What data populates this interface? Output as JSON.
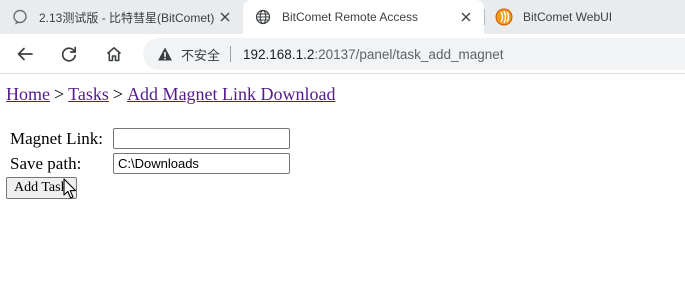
{
  "browser": {
    "tabs": [
      {
        "title": "2.13测试版 - 比特彗星(BitComet)",
        "favicon": "chat-bubble-icon",
        "active": false,
        "closable": true
      },
      {
        "title": "BitComet Remote Access",
        "favicon": "globe-icon",
        "active": true,
        "closable": true
      },
      {
        "title": "BitComet WebUI",
        "favicon": "bitcomet-logo-icon",
        "active": false,
        "closable": false
      }
    ],
    "toolbar": {
      "back_icon": "arrow-left-icon",
      "reload_icon": "reload-icon",
      "home_icon": "home-icon"
    },
    "address_bar": {
      "security_label": "不安全",
      "security_icon": "warning-triangle-icon",
      "url_host": "192.168.1.2",
      "url_rest": ":20137/panel/task_add_magnet"
    }
  },
  "page": {
    "breadcrumb": {
      "home": "Home",
      "tasks": "Tasks",
      "current": "Add Magnet Link Download",
      "separator": ">"
    },
    "form": {
      "magnet_label": "Magnet Link:",
      "magnet_value": "",
      "save_path_label": "Save path:",
      "save_path_value": "C:\\Downloads",
      "submit_label": "Add Task"
    }
  },
  "colors": {
    "link": "#551a8b",
    "tabstrip_bg": "#e9ecef",
    "omnibox_bg": "#f1f3f4",
    "warning": "#5f6368"
  }
}
